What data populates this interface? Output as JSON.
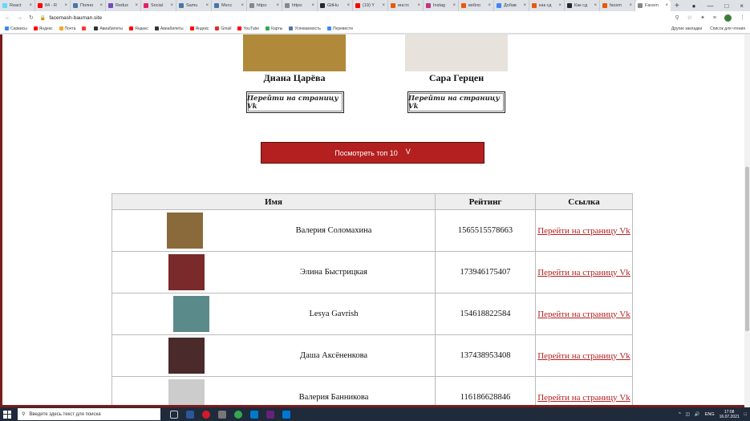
{
  "browser": {
    "tabs": [
      {
        "label": "React",
        "color": "#61dafb"
      },
      {
        "label": "84 - R",
        "color": "#ff0000"
      },
      {
        "label": "Полно",
        "color": "#4a76a8"
      },
      {
        "label": "Redux",
        "color": "#764abc"
      },
      {
        "label": "Social",
        "color": "#e91e63"
      },
      {
        "label": "Samu",
        "color": "#4a76a8"
      },
      {
        "label": "Месс",
        "color": "#4a76a8"
      },
      {
        "label": "https:",
        "color": "#888888"
      },
      {
        "label": "https:",
        "color": "#888888"
      },
      {
        "label": "GitHu",
        "color": "#24292e"
      },
      {
        "label": "(19) Y",
        "color": "#ff0000"
      },
      {
        "label": "инстс",
        "color": "#e8590c"
      },
      {
        "label": "Instag",
        "color": "#c13584"
      },
      {
        "label": "вебло",
        "color": "#e8590c"
      },
      {
        "label": "Добав",
        "color": "#4285f4"
      },
      {
        "label": "как сд",
        "color": "#e8590c"
      },
      {
        "label": "Как сд",
        "color": "#24292e"
      },
      {
        "label": "facem",
        "color": "#e8590c"
      },
      {
        "label": "Facem",
        "color": "#888888",
        "active": true
      }
    ],
    "url": "facemash-bauman.site",
    "bookmarks": [
      {
        "label": "Сервисы",
        "color": "#4285f4"
      },
      {
        "label": "Яндекс",
        "color": "#ff0000"
      },
      {
        "label": "Почта",
        "color": "#f5a623"
      },
      {
        "label": "",
        "color": "#ff3333"
      },
      {
        "label": "Авиабилеты",
        "color": "#333333"
      },
      {
        "label": "Яндекс",
        "color": "#ff0000"
      },
      {
        "label": "Авиабилеты",
        "color": "#333333"
      },
      {
        "label": "Яндекс",
        "color": "#ff0000"
      },
      {
        "label": "Gmail",
        "color": "#d93025"
      },
      {
        "label": "YouTube",
        "color": "#ff0000"
      },
      {
        "label": "Карты",
        "color": "#34a853"
      },
      {
        "label": "Успеваемость",
        "color": "#4a76a8"
      },
      {
        "label": "Перевести",
        "color": "#4285f4"
      }
    ],
    "bookmarks_right": [
      "Другие закладки",
      "Список для чтения"
    ]
  },
  "featured": [
    {
      "name": "Диана Царёва",
      "button": "Перейти на страницу Vk",
      "photo_color": "#b08a3a"
    },
    {
      "name": "Сара Герцен",
      "button": "Перейти на страницу Vk",
      "photo_color": "#e8e2dc"
    }
  ],
  "top10_button": "Посмотреть топ 10",
  "top10_chevron": "V",
  "table": {
    "headers": [
      "Имя",
      "Рейтинг",
      "Ссылка"
    ],
    "rows": [
      {
        "name": "Валерия Соломахина",
        "rating": "1565515578663",
        "link": "Перейти на страницу Vk",
        "photo_color": "#8a6a3a"
      },
      {
        "name": "Элина Быстрицкая",
        "rating": "173946175407",
        "link": "Перейти на страницу Vk",
        "photo_color": "#7a2a2a"
      },
      {
        "name": "Lesya Gavrish",
        "rating": "154618822584",
        "link": "Перейти на страницу Vk",
        "photo_color": "#5a8a8a"
      },
      {
        "name": "Даша Аксёненкова",
        "rating": "137438953408",
        "link": "Перейти на страницу Vk",
        "photo_color": "#4a2a2a"
      },
      {
        "name": "Валерия Банникова",
        "rating": "116186628846",
        "link": "Перейти на страницу Vk",
        "photo_color": "#cccccc"
      }
    ]
  },
  "taskbar": {
    "search_placeholder": "Введите здесь текст для поиска",
    "lang": "ENG",
    "time": "17:08",
    "date": "16.07.2021"
  }
}
